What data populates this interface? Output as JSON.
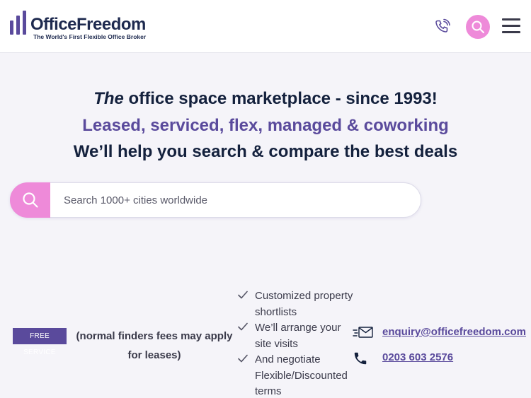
{
  "header": {
    "brand_name": "OfficeFreedom",
    "tagline": "The World's First Flexible Office Broker",
    "icons": [
      "phone-icon",
      "search-icon",
      "hamburger-menu-icon"
    ]
  },
  "hero": {
    "line1_em": "The",
    "line1_rest": " office space marketplace - since 1993!",
    "line2": "Leased, serviced, flex, managed & coworking",
    "line3": "We’ll help you search & compare the best deals"
  },
  "search": {
    "placeholder": "Search 1000+ cities worldwide",
    "value": ""
  },
  "info": {
    "badge": "FREE SERVICE",
    "note": "(normal finders fees may apply for leases)"
  },
  "features": [
    {
      "text": "Customized property shortlists"
    },
    {
      "text": "We’ll arrange your site visits"
    },
    {
      "text": "And negotiate Flexible/Discounted terms"
    }
  ],
  "contact": {
    "email": "enquiry@officefreedom.com",
    "phone": "0203 603 2576"
  },
  "colors": {
    "accent_pink": "#ee8ad9",
    "brand_purple": "#5a4a9c",
    "navy": "#14213d",
    "background": "#f5f4f9"
  }
}
